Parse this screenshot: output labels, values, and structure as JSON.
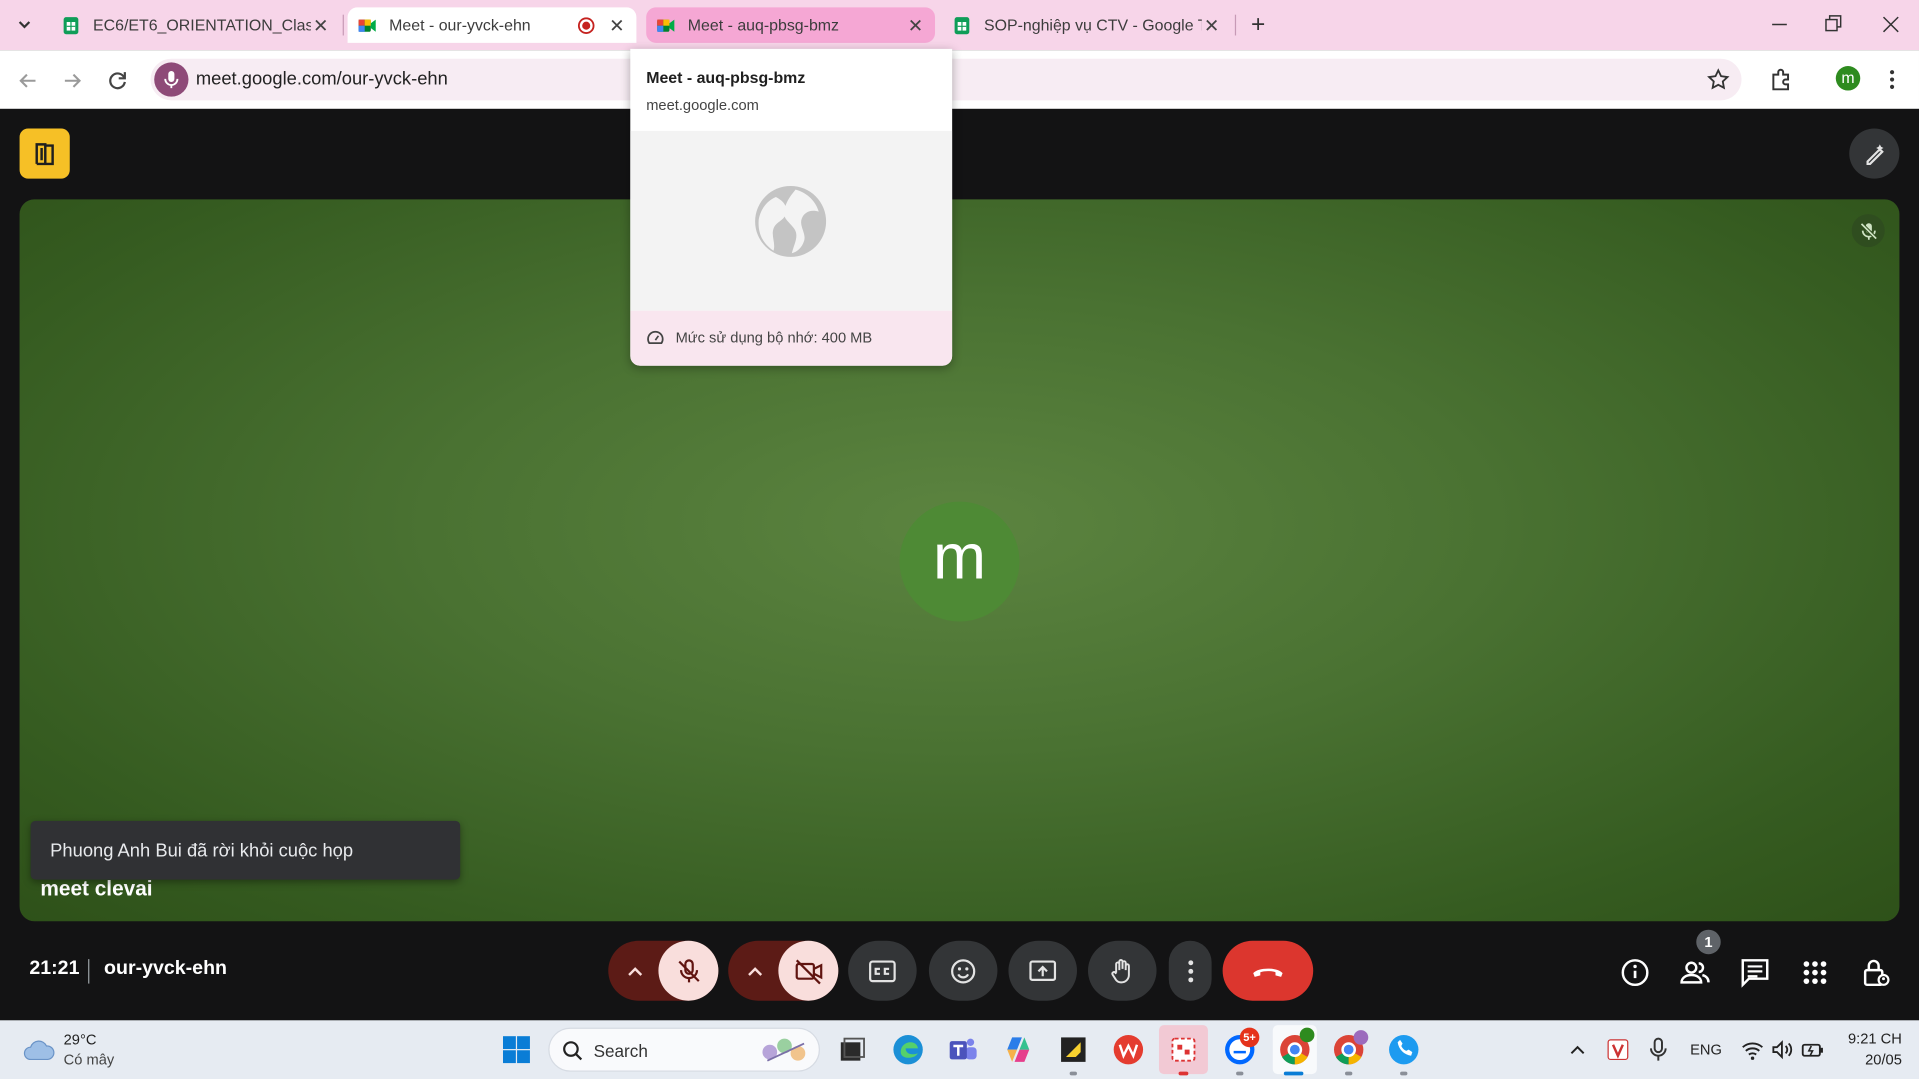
{
  "tabs": [
    {
      "title": "EC6/ET6_ORIENTATION_Class (r",
      "favicon": "sheets-icon"
    },
    {
      "title": "Meet - our-yvck-ehn",
      "favicon": "meet-icon",
      "recording": true
    },
    {
      "title": "Meet - auq-pbsg-bmz",
      "favicon": "meet-icon"
    },
    {
      "title": "SOP-nghiệp vụ CTV - Google Tr",
      "favicon": "sheets-icon"
    }
  ],
  "address": {
    "url": "meet.google.com/our-yvck-ehn"
  },
  "profile_initial": "m",
  "hover_card": {
    "title": "Meet - auq-pbsg-bmz",
    "domain": "meet.google.com",
    "memory": "Mức sử dụng bộ nhớ: 400 MB"
  },
  "meet": {
    "avatar_initial": "m",
    "participant_name": "meet clevai",
    "toast": "Phuong Anh Bui đã rời khỏi cuộc họp",
    "time": "21:21",
    "meeting_code": "our-yvck-ehn",
    "people_count": "1",
    "colors": {
      "end_call": "#dc362e",
      "mic_off_bg": "#f9dedc",
      "avatar": "#4e8a35",
      "tile": "#4a7232"
    }
  },
  "taskbar": {
    "weather_temp": "29°C",
    "weather_desc": "Có mây",
    "search_placeholder": "Search",
    "zalo_badge": "5+",
    "lang": "ENG",
    "clock_time": "9:21 CH",
    "clock_date": "20/05"
  }
}
